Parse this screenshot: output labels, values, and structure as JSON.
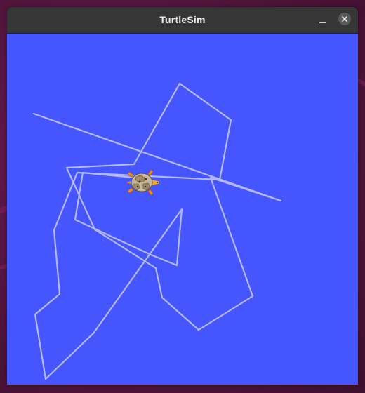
{
  "window": {
    "title": "TurtleSim"
  },
  "titlebar_buttons": {
    "minimize_icon": "minimize-icon",
    "close_icon": "close-icon"
  },
  "colors": {
    "background": "#4556ff",
    "pen": "#b3b8ff",
    "titlebar": "#363636",
    "title_text": "#ededed"
  },
  "turtle": {
    "icon": "turtle-icon",
    "heading": "east"
  }
}
